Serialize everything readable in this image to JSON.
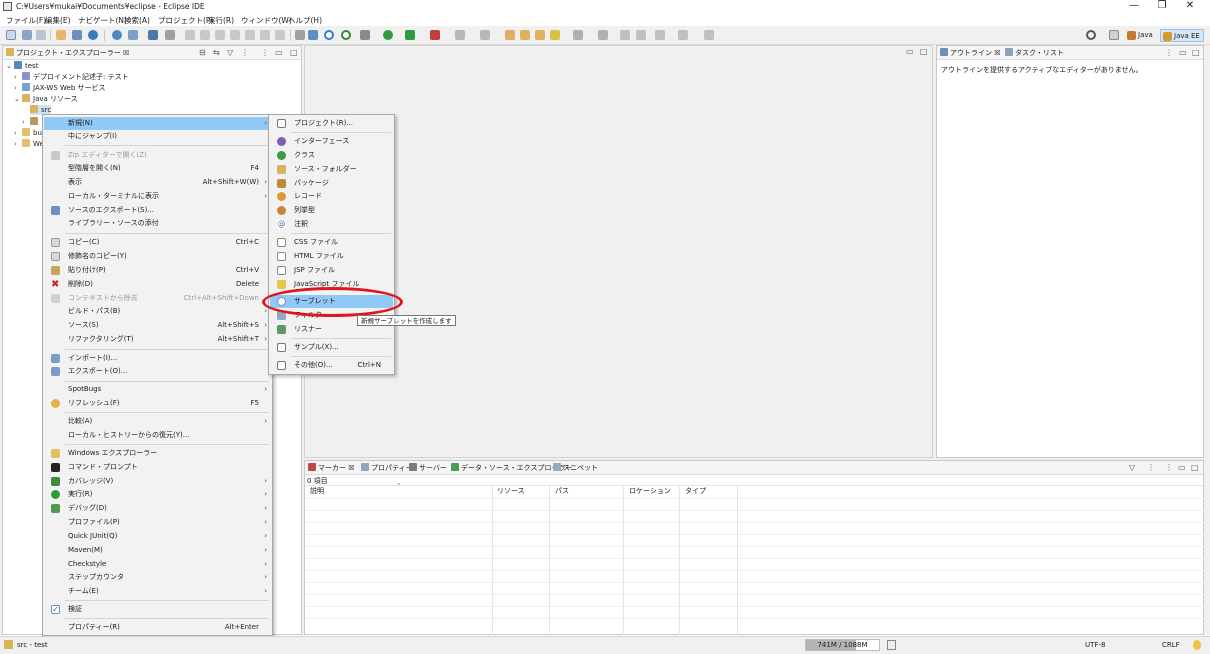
{
  "window": {
    "title": "C:¥Users¥mukai¥Documents¥eclipse - Eclipse IDE",
    "controls": {
      "minimize": "—",
      "restore": "❐",
      "close": "✕"
    }
  },
  "menubar": [
    "ファイル(F)",
    "編集(E)",
    "ナビゲート(N)",
    "検索(A)",
    "プロジェクト(P)",
    "実行(R)",
    "ウィンドウ(W)",
    "ヘルプ(H)"
  ],
  "perspectives": {
    "java": "Java",
    "java_ee": "Java EE"
  },
  "project_explorer": {
    "tab_label": "プロジェクト・エクスプローラー",
    "tree": {
      "project": "test",
      "deploy_descriptor": "デプロイメント記述子: テスト",
      "jaxws": "JAX-WS Web サービス",
      "java_resources": "Java リソース",
      "src": "src",
      "lib_abbrev": "",
      "build_abbrev": "bu",
      "web_abbrev": "We"
    }
  },
  "context_menu": {
    "items": [
      {
        "label": "新規(N)",
        "arrow": "›",
        "highlighted": true
      },
      {
        "label": "中にジャンプ(I)"
      },
      {
        "label": "Zip エディターで開く(Z)",
        "disabled": true
      },
      {
        "label": "型階層を開く(N)",
        "shortcut": "F4"
      },
      {
        "label": "表示",
        "shortcut": "Alt+Shift+W(W)",
        "arrow": "›"
      },
      {
        "label": "ローカル・ターミナルに表示",
        "arrow": "›"
      },
      {
        "label": "ソースのエクスポート(S)..."
      },
      {
        "label": "ライブラリー・ソースの添付"
      },
      {
        "label": "コピー(C)",
        "shortcut": "Ctrl+C"
      },
      {
        "label": "修飾名のコピー(Y)"
      },
      {
        "label": "貼り付け(P)",
        "shortcut": "Ctrl+V"
      },
      {
        "label": "削除(D)",
        "shortcut": "Delete"
      },
      {
        "label": "コンテキストから除去",
        "shortcut": "Ctrl+Alt+Shift+Down",
        "disabled": true
      },
      {
        "label": "ビルド・パス(B)",
        "arrow": "›"
      },
      {
        "label": "ソース(S)",
        "shortcut": "Alt+Shift+S",
        "arrow": "›"
      },
      {
        "label": "リファクタリング(T)",
        "shortcut": "Alt+Shift+T",
        "arrow": "›"
      },
      {
        "label": "インポート(I)..."
      },
      {
        "label": "エクスポート(O)..."
      },
      {
        "label": "SpotBugs",
        "arrow": "›"
      },
      {
        "label": "リフレッシュ(F)",
        "shortcut": "F5"
      },
      {
        "label": "比較(A)",
        "arrow": "›"
      },
      {
        "label": "ローカル・ヒストリーからの復元(Y)..."
      },
      {
        "label": "Windows エクスプローラー"
      },
      {
        "label": "コマンド・プロンプト"
      },
      {
        "label": "カバレッジ(V)",
        "arrow": "›"
      },
      {
        "label": "実行(R)",
        "arrow": "›"
      },
      {
        "label": "デバッグ(D)",
        "arrow": "›"
      },
      {
        "label": "プロファイル(P)",
        "arrow": "›"
      },
      {
        "label": "Quick JUnit(Q)",
        "arrow": "›"
      },
      {
        "label": "Maven(M)",
        "arrow": "›"
      },
      {
        "label": "Checkstyle",
        "arrow": "›"
      },
      {
        "label": "ステップカウンタ",
        "arrow": "›"
      },
      {
        "label": "チーム(E)",
        "arrow": "›"
      },
      {
        "label": "検証"
      },
      {
        "label": "プロパティー(R)",
        "shortcut": "Alt+Enter"
      }
    ]
  },
  "new_submenu": {
    "items": [
      {
        "label": "プロジェクト(R)..."
      },
      {
        "label": "インターフェース"
      },
      {
        "label": "クラス"
      },
      {
        "label": "ソース・フォルダー"
      },
      {
        "label": "パッケージ"
      },
      {
        "label": "レコード"
      },
      {
        "label": "列挙型"
      },
      {
        "label": "注釈"
      },
      {
        "label": "CSS ファイル"
      },
      {
        "label": "HTML ファイル"
      },
      {
        "label": "JSP ファイル"
      },
      {
        "label": "JavaScript ファイル"
      },
      {
        "label": "サーブレット",
        "highlighted": true
      },
      {
        "label": "フィルター"
      },
      {
        "label": "リスナー"
      },
      {
        "label": "サンプル(X)..."
      },
      {
        "label": "その他(O)...",
        "shortcut": "Ctrl+N"
      }
    ],
    "tooltip": "新規サーブレットを作成します"
  },
  "outline": {
    "tabs": [
      "アウトライン",
      "タスク・リスト"
    ],
    "message": "アウトラインを提供するアクティブなエディターがありません。"
  },
  "bottom_panel": {
    "tabs": [
      "マーカー",
      "プロパティー",
      "サーバー",
      "データ・ソース・エクスプローラー",
      "スニペット"
    ],
    "count": "0 項目",
    "columns": [
      "説明",
      "リソース",
      "パス",
      "ロケーション",
      "タイプ"
    ]
  },
  "statusbar": {
    "selection": "src - test",
    "heap": "741M / 1088M",
    "heap_used_fraction": 0.68,
    "encoding": "UTF-8",
    "line_delimiter": "CRLF"
  },
  "colors": {
    "menu_highlight": "#90c8f6",
    "annotation_red": "#e0161e"
  }
}
